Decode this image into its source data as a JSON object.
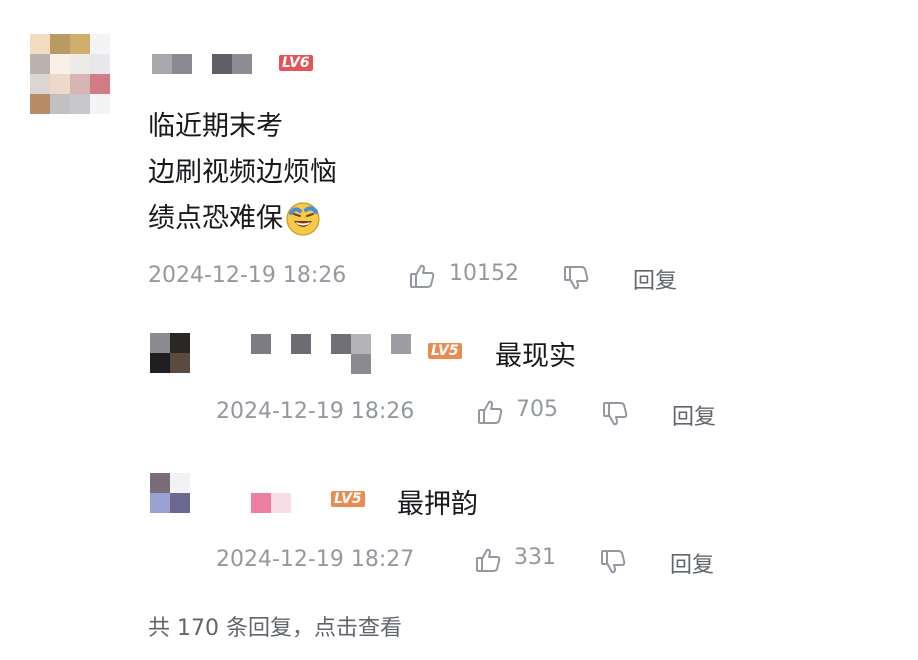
{
  "comment": {
    "level_badge": "LV6",
    "lines": [
      "临近期末考",
      "边刷视频边烦恼",
      "绩点恐难保"
    ],
    "emoji_icon": "laughing-crying-emoji-icon",
    "time": "2024-12-19 18:26",
    "likes": "10152",
    "reply_label": "回复"
  },
  "replies": [
    {
      "level_badge": "LV5",
      "text": "最现实",
      "time": "2024-12-19 18:26",
      "likes": "705",
      "reply_label": "回复"
    },
    {
      "level_badge": "LV5",
      "text": "最押韵",
      "time": "2024-12-19 18:27",
      "likes": "331",
      "reply_label": "回复"
    }
  ],
  "footer": {
    "text": "共 170 条回复，点击查看"
  },
  "colors": {
    "text": "#18191c",
    "meta": "#9499a0",
    "lv6": "#e2555a",
    "lv5": "#e98b52"
  }
}
